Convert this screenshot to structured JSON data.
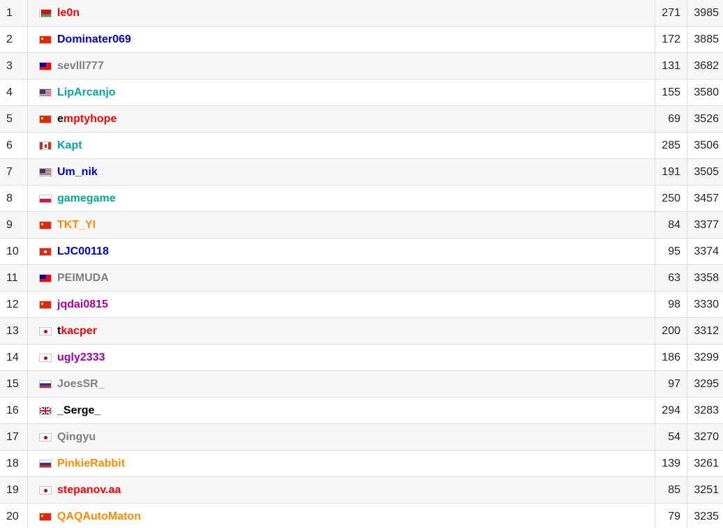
{
  "ranking": {
    "rows": [
      {
        "rank": "1",
        "flag": "by",
        "handle_first": "",
        "handle": "le0n",
        "color": "c-red",
        "count": "271",
        "rating": "3985"
      },
      {
        "rank": "2",
        "flag": "cn",
        "handle_first": "",
        "handle": "Dominater069",
        "color": "c-blue",
        "count": "172",
        "rating": "3885"
      },
      {
        "rank": "3",
        "flag": "tw",
        "handle_first": "",
        "handle": "sevlll777",
        "color": "c-gray",
        "count": "131",
        "rating": "3682"
      },
      {
        "rank": "4",
        "flag": "us",
        "handle_first": "",
        "handle": "LipArcanjo",
        "color": "c-cyan",
        "count": "155",
        "rating": "3580"
      },
      {
        "rank": "5",
        "flag": "cn",
        "handle_first": "e",
        "handle": "mptyhope",
        "color": "c-legendary",
        "count": "69",
        "rating": "3526"
      },
      {
        "rank": "6",
        "flag": "ca",
        "handle_first": "",
        "handle": "Kapt",
        "color": "c-cyan",
        "count": "285",
        "rating": "3506"
      },
      {
        "rank": "7",
        "flag": "us",
        "handle_first": "",
        "handle": "Um_nik",
        "color": "c-blue",
        "count": "191",
        "rating": "3505"
      },
      {
        "rank": "8",
        "flag": "pl",
        "handle_first": "",
        "handle": "gamegame",
        "color": "c-cyan",
        "count": "250",
        "rating": "3457"
      },
      {
        "rank": "9",
        "flag": "cn",
        "handle_first": "",
        "handle": "TKT_YI",
        "color": "c-orange",
        "count": "84",
        "rating": "3377"
      },
      {
        "rank": "10",
        "flag": "hk",
        "handle_first": "",
        "handle": "LJC00118",
        "color": "c-blue",
        "count": "95",
        "rating": "3374"
      },
      {
        "rank": "11",
        "flag": "tw",
        "handle_first": "",
        "handle": "PEIMUDA",
        "color": "c-gray",
        "count": "63",
        "rating": "3358"
      },
      {
        "rank": "12",
        "flag": "cn",
        "handle_first": "",
        "handle": "jqdai0815",
        "color": "c-violet",
        "count": "98",
        "rating": "3330"
      },
      {
        "rank": "13",
        "flag": "jp",
        "handle_first": "t",
        "handle": "kacper",
        "color": "c-legendary",
        "count": "200",
        "rating": "3312"
      },
      {
        "rank": "14",
        "flag": "jp",
        "handle_first": "",
        "handle": "ugly2333",
        "color": "c-violet",
        "count": "186",
        "rating": "3299"
      },
      {
        "rank": "15",
        "flag": "ru",
        "handle_first": "",
        "handle": "JoesSR_",
        "color": "c-gray",
        "count": "97",
        "rating": "3295"
      },
      {
        "rank": "16",
        "flag": "gb",
        "handle_first": "",
        "handle": "_Serge_",
        "color": "c-black",
        "count": "294",
        "rating": "3283"
      },
      {
        "rank": "17",
        "flag": "jp",
        "handle_first": "",
        "handle": "Qingyu",
        "color": "c-gray",
        "count": "54",
        "rating": "3270"
      },
      {
        "rank": "18",
        "flag": "ru",
        "handle_first": "",
        "handle": "PinkieRabbit",
        "color": "c-orange",
        "count": "139",
        "rating": "3261"
      },
      {
        "rank": "19",
        "flag": "jp",
        "handle_first": "",
        "handle": "stepanov.aa",
        "color": "c-red",
        "count": "85",
        "rating": "3251"
      },
      {
        "rank": "20",
        "flag": "cn",
        "handle_first": "",
        "handle": "QAQAutoMaton",
        "color": "c-orange",
        "count": "79",
        "rating": "3235"
      }
    ]
  },
  "colors": {
    "red": "#ff0000",
    "blue": "#0000cc",
    "gray": "#808080",
    "cyan": "#03a89e",
    "orange": "#ff8c00",
    "violet": "#aa00aa",
    "black": "#000000",
    "row_alt": "#f7f7f7",
    "border": "#dddddd"
  },
  "icons": {
    "by": "belarus-flag-icon",
    "cn": "china-flag-icon",
    "tw": "taiwan-flag-icon",
    "us": "usa-flag-icon",
    "ca": "canada-flag-icon",
    "pl": "poland-flag-icon",
    "hk": "hong-kong-flag-icon",
    "jp": "japan-flag-icon",
    "ru": "russia-flag-icon",
    "gb": "united-kingdom-flag-icon"
  }
}
